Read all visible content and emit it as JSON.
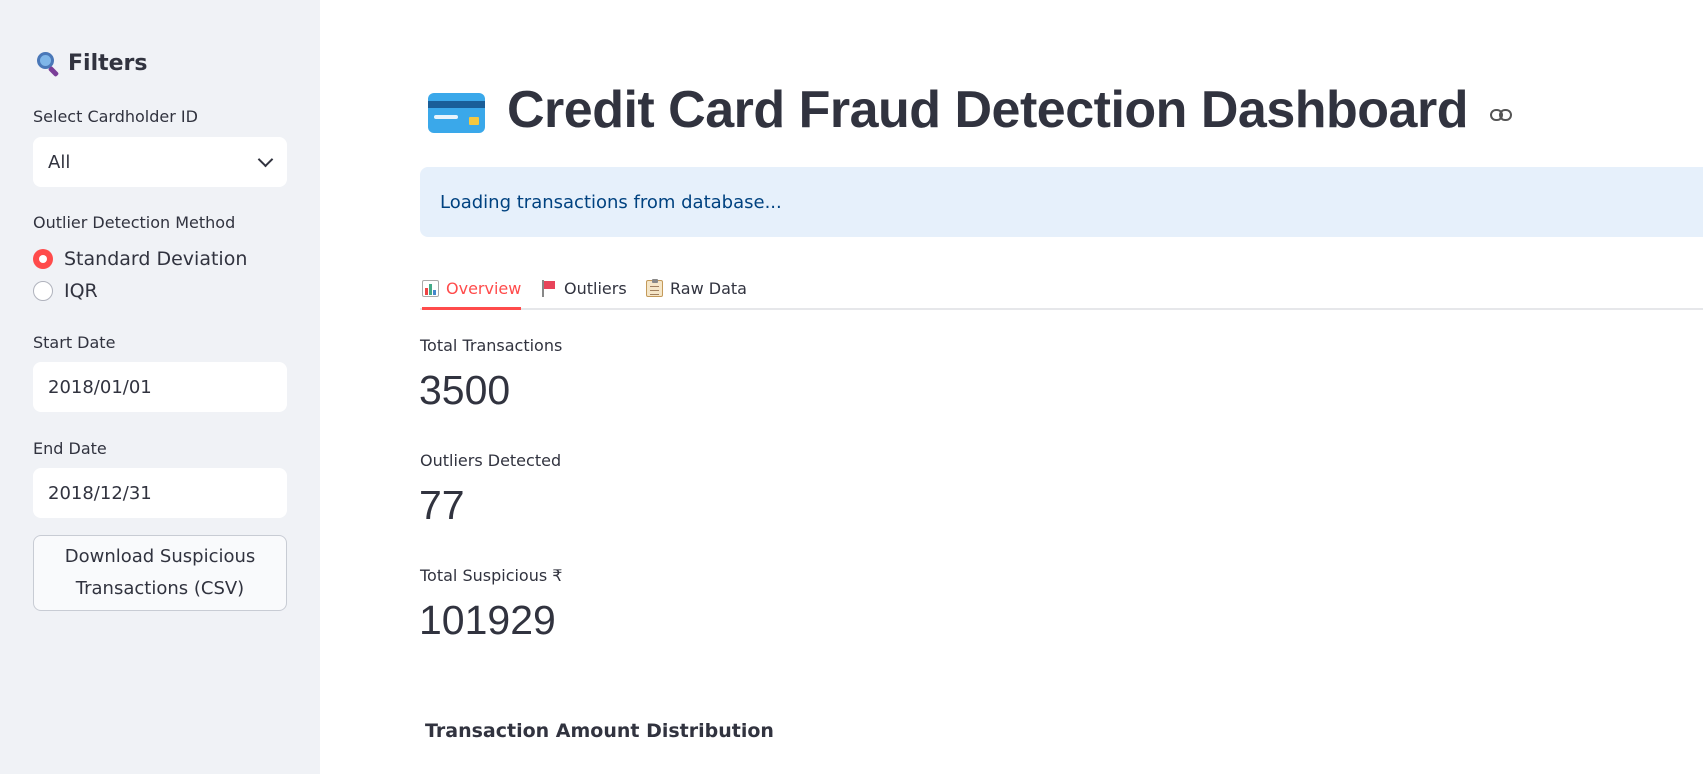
{
  "sidebar": {
    "title": "Filters",
    "title_icon": "magnifying-glass-icon",
    "cardholder_label": "Select Cardholder ID",
    "cardholder_value": "All",
    "method_label": "Outlier Detection Method",
    "method_options": [
      "Standard Deviation",
      "IQR"
    ],
    "method_selected": "Standard Deviation",
    "start_date_label": "Start Date",
    "start_date_value": "2018/01/01",
    "end_date_label": "End Date",
    "end_date_value": "2018/12/31",
    "download_label_line1": "Download Suspicious",
    "download_label_line2": "Transactions (CSV)"
  },
  "main": {
    "title": "Credit Card Fraud Detection Dashboard",
    "title_icon": "credit-card-icon",
    "info_message": "Loading transactions from database...",
    "tabs": [
      {
        "label": "Overview",
        "icon": "bar-chart-icon",
        "active": true
      },
      {
        "label": "Outliers",
        "icon": "flag-icon",
        "active": false
      },
      {
        "label": "Raw Data",
        "icon": "clipboard-icon",
        "active": false
      }
    ],
    "metrics": [
      {
        "label": "Total Transactions",
        "value": "3500"
      },
      {
        "label": "Outliers Detected",
        "value": "77"
      },
      {
        "label": "Total Suspicious ₹",
        "value": "101929"
      }
    ],
    "section_heading": "Transaction Amount Distribution"
  },
  "colors": {
    "accent": "#ff4b4b",
    "sidebar_bg": "#f0f2f6",
    "info_bg": "#e6f0fb",
    "info_text": "#004280",
    "text": "#31333f"
  }
}
